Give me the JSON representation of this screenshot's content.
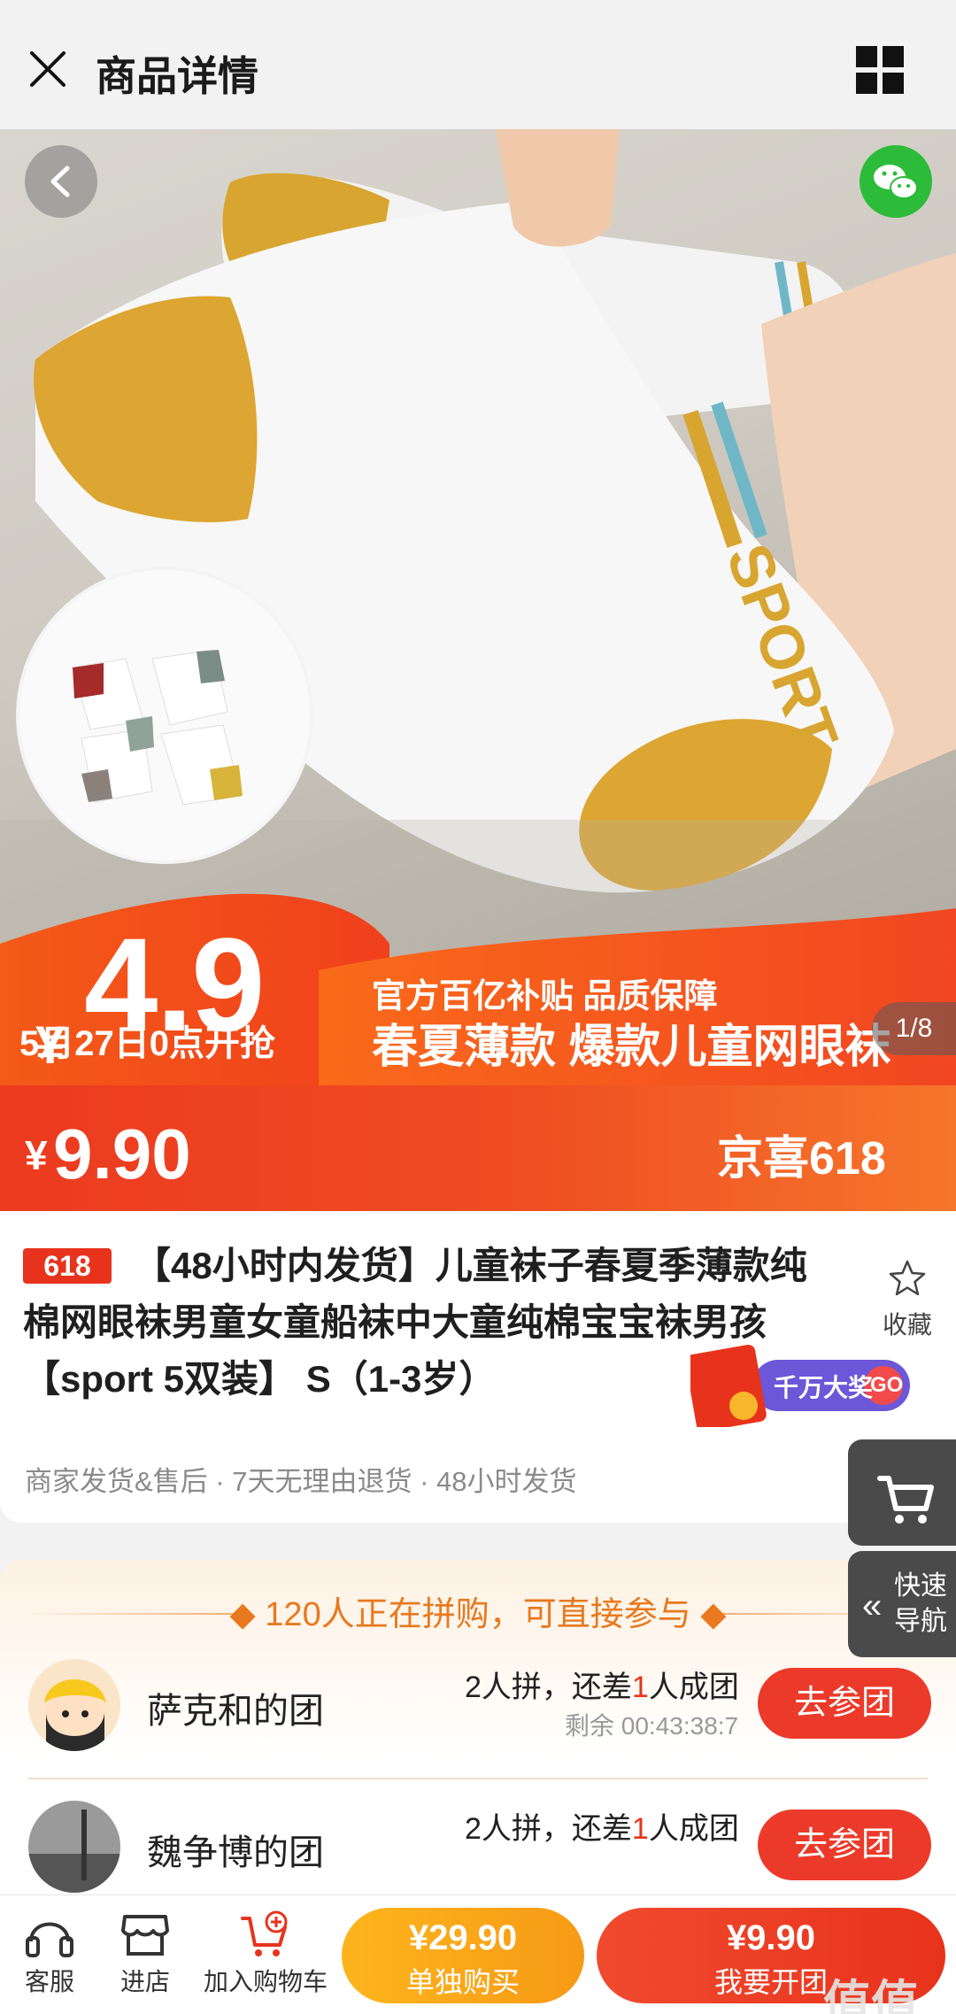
{
  "header": {
    "title": "商品详情",
    "close_icon": "close-icon",
    "menu_icon": "grid-menu-icon"
  },
  "hero": {
    "promo_price_currency": "¥",
    "promo_price": "4.9",
    "sale_date": "5月27日0点开抢",
    "subsidy_text": "官方百亿补贴 品质保障",
    "headline": "春夏薄款  爆款儿童网眼袜",
    "image_counter": "1/8"
  },
  "price": {
    "currency": "¥",
    "amount": "9.90",
    "campaign": "京喜618"
  },
  "product": {
    "tag": "618",
    "title": "【48小时内发货】儿童袜子春夏季薄款纯棉网眼袜男童女童船袜中大童纯棉宝宝袜男孩 【sport 5双装】 S（1-3岁）",
    "favorite_label": "收藏",
    "promo_badge": "千万大奖",
    "promo_go": "GO",
    "services": "商家发货&售后 · 7天无理由退货 · 48小时发货"
  },
  "group_buy": {
    "heading": "120人正在拼购，可直接参与",
    "rows": [
      {
        "name": "萨克和的团",
        "status_pre": "2人拼，还差",
        "status_num": "1",
        "status_post": "人成团",
        "remain": "剩余 00:43:38:7",
        "button": "去参团"
      },
      {
        "name": "魏争博的团",
        "status_pre": "2人拼，还差",
        "status_num": "1",
        "status_post": "人成团",
        "remain": "",
        "button": "去参团"
      }
    ]
  },
  "side": {
    "nav_label_1": "快速",
    "nav_label_2": "导航"
  },
  "bottom_bar": {
    "service": "客服",
    "store": "进店",
    "add_cart": "加入购物车",
    "solo_price": "¥29.90",
    "solo_label": "单独购买",
    "group_price": "¥9.90",
    "group_label": "我要开团"
  },
  "watermark": "值值值"
}
